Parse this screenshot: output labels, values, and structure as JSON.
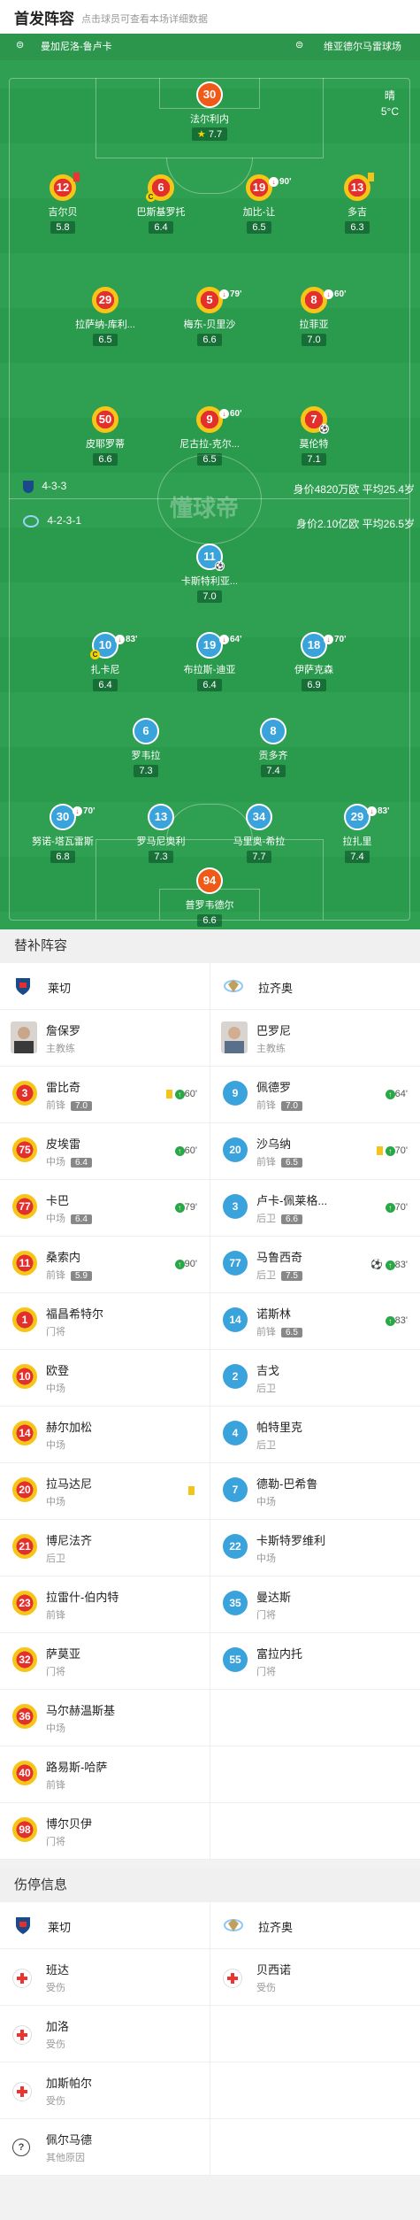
{
  "header": {
    "title": "首发阵容",
    "subtitle": "点击球员可查看本场详细数据"
  },
  "venue": {
    "home": "曼加尼洛-鲁卢卡",
    "away": "维亚德尔马雷球场"
  },
  "weather": {
    "condition": "晴",
    "temp": "5°C"
  },
  "watermark": "懂球帝",
  "home": {
    "formation": "4-3-3",
    "info": "身价4820万欧  平均25.4岁"
  },
  "away": {
    "formation": "4-2-3-1",
    "info": "身价2.10亿欧  平均26.5岁"
  },
  "lecce_players": [
    {
      "num": "30",
      "name": "法尔利内",
      "rating": "7.7"
    },
    {
      "num": "12",
      "name": "吉尔贝",
      "rating": "5.8"
    },
    {
      "num": "6",
      "name": "巴斯基罗托",
      "rating": "6.4"
    },
    {
      "num": "19",
      "name": "加比-让",
      "rating": "6.5",
      "sub": "90'"
    },
    {
      "num": "13",
      "name": "多吉",
      "rating": "6.3"
    },
    {
      "num": "29",
      "name": "拉萨纳-库利...",
      "rating": "6.5"
    },
    {
      "num": "5",
      "name": "梅东-贝里沙",
      "rating": "6.6",
      "sub": "79'"
    },
    {
      "num": "8",
      "name": "拉菲亚",
      "rating": "7.0",
      "sub": "60'"
    },
    {
      "num": "50",
      "name": "皮耶罗蒂",
      "rating": "6.6"
    },
    {
      "num": "9",
      "name": "尼古拉-克尔...",
      "rating": "6.5",
      "sub": "60'"
    },
    {
      "num": "7",
      "name": "莫伦特",
      "rating": "7.1"
    }
  ],
  "lazio_players": [
    {
      "num": "11",
      "name": "卡斯特利亚...",
      "rating": "7.0"
    },
    {
      "num": "10",
      "name": "扎卡尼",
      "rating": "6.4",
      "sub": "83'"
    },
    {
      "num": "19",
      "name": "布拉斯-迪亚",
      "rating": "6.4",
      "sub": "64'"
    },
    {
      "num": "18",
      "name": "伊萨克森",
      "rating": "6.9",
      "sub": "70'"
    },
    {
      "num": "6",
      "name": "罗韦拉",
      "rating": "7.3"
    },
    {
      "num": "8",
      "name": "贡多齐",
      "rating": "7.4"
    },
    {
      "num": "30",
      "name": "努诺-塔瓦雷斯",
      "rating": "6.8",
      "sub": "70'"
    },
    {
      "num": "13",
      "name": "罗马尼奥利",
      "rating": "7.3"
    },
    {
      "num": "34",
      "name": "马里奥-希拉",
      "rating": "7.7"
    },
    {
      "num": "29",
      "name": "拉扎里",
      "rating": "7.4",
      "sub": "83'"
    },
    {
      "num": "94",
      "name": "普罗韦德尔",
      "rating": "6.6"
    }
  ],
  "subs": {
    "title": "替补阵容",
    "lecce_team": "莱切",
    "lazio_team": "拉齐奥",
    "lecce_coach": {
      "name": "詹保罗",
      "role": "主教练"
    },
    "lazio_coach": {
      "name": "巴罗尼",
      "role": "主教练"
    },
    "lecce": [
      {
        "num": "3",
        "name": "雷比奇",
        "pos": "前锋",
        "rating": "7.0",
        "card": true,
        "in": "60'"
      },
      {
        "num": "75",
        "name": "皮埃雷",
        "pos": "中场",
        "rating": "6.4",
        "in": "60'"
      },
      {
        "num": "77",
        "name": "卡巴",
        "pos": "中场",
        "rating": "6.4",
        "in": "79'"
      },
      {
        "num": "11",
        "name": "桑索内",
        "pos": "前锋",
        "rating": "5.9",
        "in": "90'"
      },
      {
        "num": "1",
        "name": "福昌希特尔",
        "pos": "门将"
      },
      {
        "num": "10",
        "name": "欧登",
        "pos": "中场"
      },
      {
        "num": "14",
        "name": "赫尔加松",
        "pos": "中场"
      },
      {
        "num": "20",
        "name": "拉马达尼",
        "pos": "中场",
        "card": true
      },
      {
        "num": "21",
        "name": "博尼法齐",
        "pos": "后卫"
      },
      {
        "num": "23",
        "name": "拉雷什-伯内特",
        "pos": "前锋"
      },
      {
        "num": "32",
        "name": "萨莫亚",
        "pos": "门将"
      },
      {
        "num": "36",
        "name": "马尔赫温斯基",
        "pos": "中场"
      },
      {
        "num": "40",
        "name": "路易斯-哈萨",
        "pos": "前锋"
      },
      {
        "num": "98",
        "name": "博尔贝伊",
        "pos": "门将"
      }
    ],
    "lazio": [
      {
        "num": "9",
        "name": "佩德罗",
        "pos": "前锋",
        "rating": "7.0",
        "in": "64'"
      },
      {
        "num": "20",
        "name": "沙乌纳",
        "pos": "前锋",
        "rating": "6.5",
        "card": true,
        "in": "70'"
      },
      {
        "num": "3",
        "name": "卢卡-佩莱格...",
        "pos": "后卫",
        "rating": "6.6",
        "in": "70'"
      },
      {
        "num": "77",
        "name": "马鲁西奇",
        "pos": "后卫",
        "rating": "7.5",
        "ball": true,
        "in": "83'"
      },
      {
        "num": "14",
        "name": "诺斯林",
        "pos": "前锋",
        "rating": "6.5",
        "in": "83'"
      },
      {
        "num": "2",
        "name": "吉戈",
        "pos": "后卫"
      },
      {
        "num": "4",
        "name": "帕特里克",
        "pos": "后卫"
      },
      {
        "num": "7",
        "name": "德勒-巴希鲁",
        "pos": "中场"
      },
      {
        "num": "22",
        "name": "卡斯特罗维利",
        "pos": "中场"
      },
      {
        "num": "35",
        "name": "曼达斯",
        "pos": "门将"
      },
      {
        "num": "55",
        "name": "富拉内托",
        "pos": "门将"
      }
    ]
  },
  "injuries": {
    "title": "伤停信息",
    "lecce_team": "莱切",
    "lazio_team": "拉齐奥",
    "lecce": [
      {
        "name": "班达",
        "reason": "受伤",
        "type": "injury"
      },
      {
        "name": "加洛",
        "reason": "受伤",
        "type": "injury"
      },
      {
        "name": "加斯帕尔",
        "reason": "受伤",
        "type": "injury"
      },
      {
        "name": "佩尔马德",
        "reason": "其他原因",
        "type": "other"
      }
    ],
    "lazio": [
      {
        "name": "贝西诺",
        "reason": "受伤",
        "type": "injury"
      }
    ]
  }
}
